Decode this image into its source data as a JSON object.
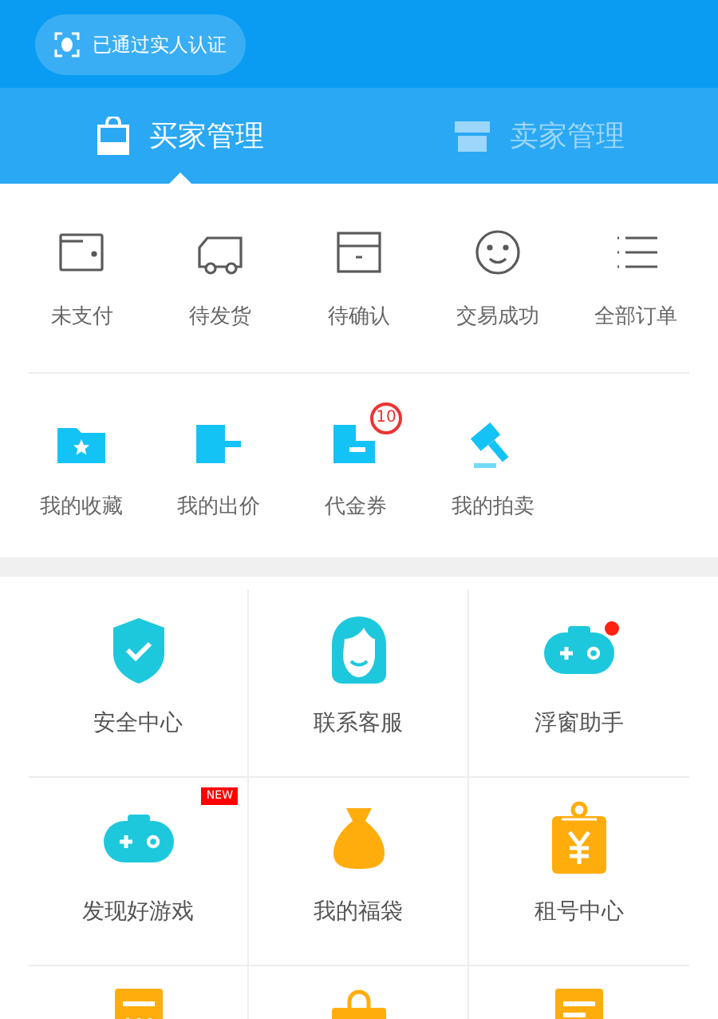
{
  "verify_badge": {
    "label": "已通过实人认证"
  },
  "tabs": [
    {
      "label": "买家管理",
      "selected": true
    },
    {
      "label": "卖家管理",
      "selected": false
    }
  ],
  "orders": [
    {
      "label": "未支付"
    },
    {
      "label": "待发货"
    },
    {
      "label": "待确认"
    },
    {
      "label": "交易成功"
    },
    {
      "label": "全部订单"
    }
  ],
  "tools": [
    {
      "label": "我的收藏"
    },
    {
      "label": "我的出价"
    },
    {
      "label": "代金券",
      "badge": "10"
    },
    {
      "label": "我的拍卖"
    }
  ],
  "services": [
    {
      "label": "安全中心",
      "dot": false
    },
    {
      "label": "联系客服",
      "dot": false
    },
    {
      "label": "浮窗助手",
      "dot": true
    },
    {
      "label": "发现好游戏",
      "dot": false,
      "badge": "NEW"
    },
    {
      "label": "我的福袋",
      "dot": false
    },
    {
      "label": "租号中心",
      "dot": false
    },
    {
      "dot": false
    },
    {
      "dot": false
    },
    {
      "dot": false
    }
  ]
}
